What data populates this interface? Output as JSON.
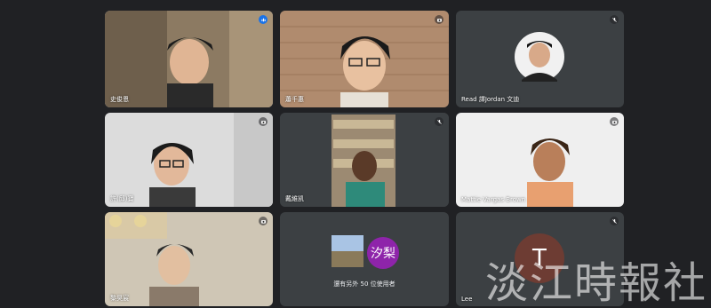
{
  "tiles": [
    {
      "name": "史俊恩",
      "speaking": true
    },
    {
      "name": "蕭千惠"
    },
    {
      "name": "Read 譯Jordan 文迪"
    },
    {
      "name": "許(邱)寶"
    },
    {
      "name": "戴維凯"
    },
    {
      "name": "Mattie Vargas Brown"
    },
    {
      "name": "黎昊宸"
    },
    {
      "name": ""
    },
    {
      "name": "Lee"
    }
  ],
  "others": {
    "label": "還有另外 50 位使用者",
    "avatar_letter": "汐梨",
    "avatar_color": "#8e24aa"
  },
  "t_avatar": {
    "letter": "T",
    "color": "#6d3c33"
  },
  "watermark": "淡江時報社",
  "colors": {
    "background": "#202124",
    "tile": "#3c4043",
    "active": "#1a73e8"
  }
}
